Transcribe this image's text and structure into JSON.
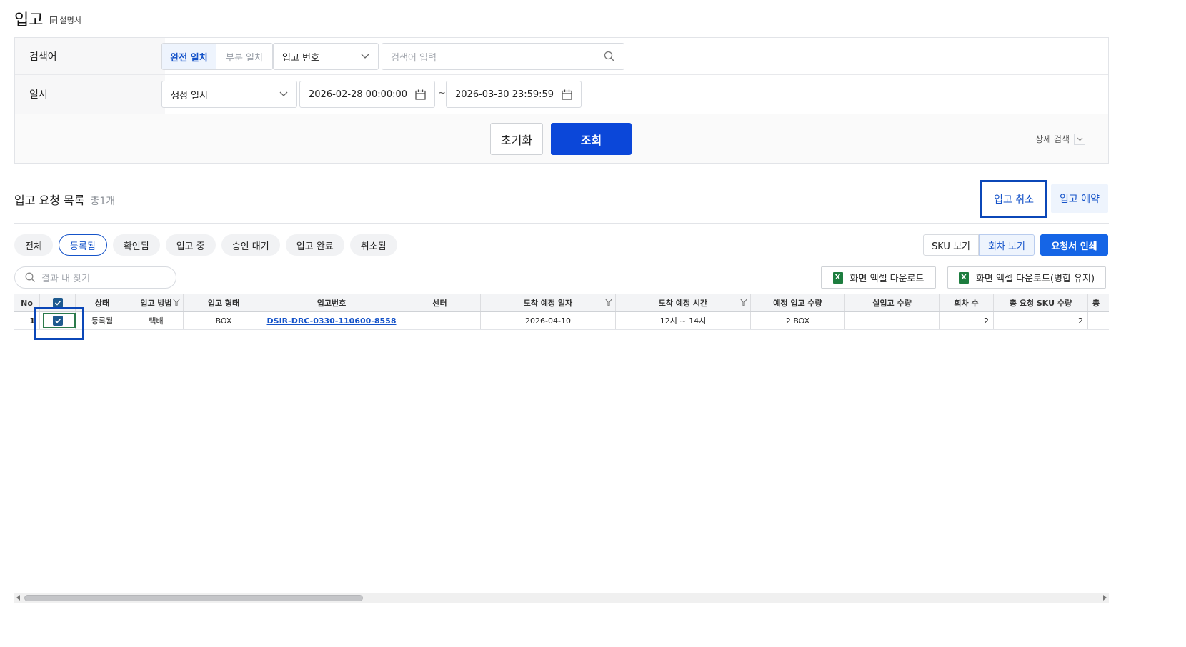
{
  "page": {
    "title": "입고",
    "doc_link": "설명서"
  },
  "search": {
    "keyword_label": "검색어",
    "match_exact": "완전 일치",
    "match_partial": "부분 일치",
    "field_select": "입고 번호",
    "keyword_placeholder": "검색어 입력",
    "date_label": "일시",
    "date_type_select": "생성 일시",
    "date_from": "2026-02-28 00:00:00",
    "date_sep": "~",
    "date_to": "2026-03-30 23:59:59",
    "reset_label": "초기화",
    "query_label": "조회",
    "advanced_label": "상세 검색"
  },
  "list": {
    "title": "입고 요청 목록",
    "count": "총1개",
    "cancel_label": "입고 취소",
    "reserve_label": "입고 예약",
    "status_tabs": [
      "전체",
      "등록됨",
      "확인됨",
      "입고 중",
      "승인 대기",
      "입고 완료",
      "취소됨"
    ],
    "active_tab": "등록됨",
    "sku_view_label": "SKU 보기",
    "round_view_label": "회차 보기",
    "print_label": "요청서 인쇄",
    "result_search_placeholder": "결과 내 찾기",
    "excel_download_label": "화면 엑셀 다운로드",
    "excel_download_merged_label": "화면 엑셀 다운로드(병합 유지)"
  },
  "grid": {
    "columns": [
      "No",
      "",
      "상태",
      "입고 방법",
      "입고 형태",
      "입고번호",
      "센터",
      "도착 예정 일자",
      "도착 예정 시간",
      "예정 입고 수량",
      "실입고 수량",
      "회차 수",
      "총 요청 SKU 수량",
      "총"
    ],
    "rows": [
      {
        "no": "1",
        "status": "등록됨",
        "method": "택배",
        "type": "BOX",
        "number": "DSIR-DRC-0330-110600-8558",
        "center": "",
        "arrival_date": "2026-04-10",
        "arrival_time": "12시 ~ 14시",
        "planned_qty": "2 BOX",
        "actual_qty": "",
        "rounds": "2",
        "total_sku": "2"
      }
    ]
  },
  "colors": {
    "primary": "#0b47d9",
    "accent_blue": "#1553c9",
    "highlight_border": "#0b47b8",
    "excel_green": "#1d7d3f"
  }
}
